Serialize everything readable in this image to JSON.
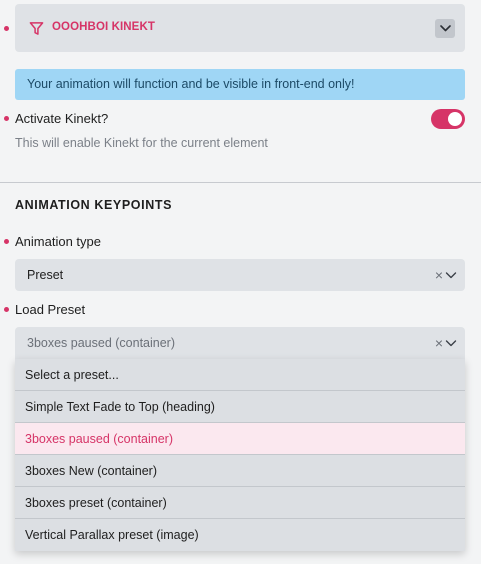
{
  "header": {
    "title": "OOOHBOI KINEKT",
    "icon": "filter-icon",
    "accent_color": "#d63467"
  },
  "notice": {
    "text": "Your animation will function and be visible in front-end only!"
  },
  "activate": {
    "label": "Activate Kinekt?",
    "help": "This will enable Kinekt for the current element",
    "enabled": true
  },
  "section": {
    "title": "ANIMATION KEYPOINTS"
  },
  "animation_type": {
    "label": "Animation type",
    "value": "Preset",
    "clear_glyph": "×"
  },
  "load_preset": {
    "label": "Load Preset",
    "value": "3boxes paused (container)",
    "clear_glyph": "×",
    "options": [
      "Select a preset...",
      "Simple Text Fade to Top (heading)",
      "3boxes paused (container)",
      "3boxes New (container)",
      "3boxes preset (container)",
      "Vertical Parallax preset (image)"
    ],
    "selected_index": 2
  }
}
